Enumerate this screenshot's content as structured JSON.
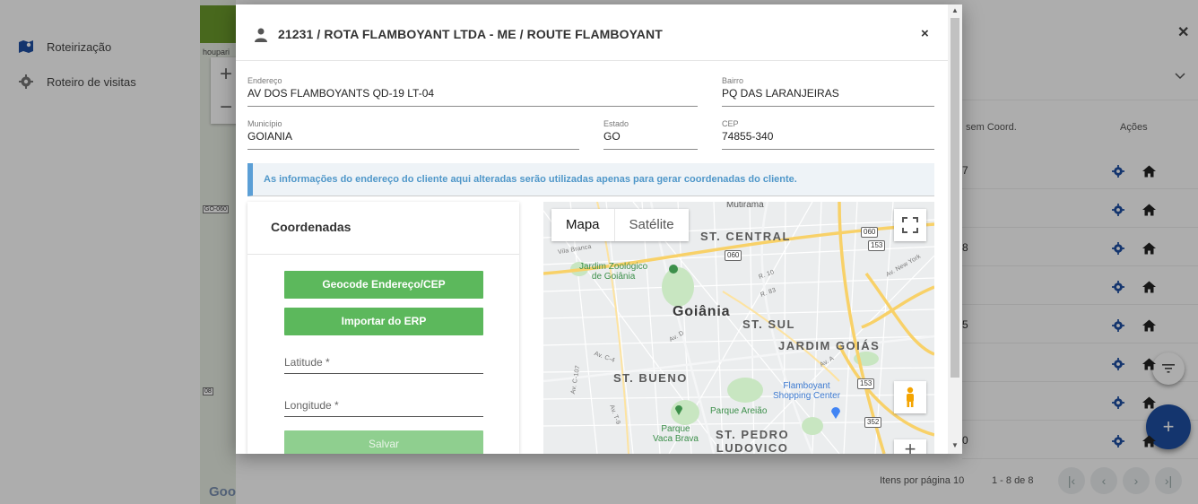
{
  "sidebar": {
    "items": [
      {
        "label": "Roteirização",
        "icon": "map-route-icon"
      },
      {
        "label": "Roteiro de visitas",
        "icon": "gear-icon"
      }
    ]
  },
  "background": {
    "map_credit": "Goo",
    "map_strip_text": "houpari",
    "road_codes": [
      "GO-060",
      "08"
    ],
    "table": {
      "col_sem_coord": "sem Coord.",
      "col_acoes": "Ações",
      "rows": [
        "7",
        "",
        "8",
        "",
        "5",
        "",
        "",
        "0"
      ]
    },
    "footer": {
      "items_per_page": "Itens por página 10",
      "range": "1 - 8 de 8"
    }
  },
  "modal": {
    "title": "21231 / ROTA FLAMBOYANT LTDA - ME / ROUTE FLAMBOYANT",
    "close": "×",
    "fields": {
      "endereco": {
        "label": "Endereço",
        "value": "AV DOS FLAMBOYANTS QD-19 LT-04"
      },
      "bairro": {
        "label": "Bairro",
        "value": "PQ DAS LARANJEIRAS"
      },
      "municipio": {
        "label": "Município",
        "value": "GOIANIA"
      },
      "estado": {
        "label": "Estado",
        "value": "GO"
      },
      "cep": {
        "label": "CEP",
        "value": "74855-340"
      }
    },
    "info": "As informações do endereço do cliente aqui alteradas serão utilizadas apenas para gerar coordenadas do cliente.",
    "coords": {
      "title": "Coordenadas",
      "geocode_button": "Geocode Endereço/CEP",
      "import_button": "Importar do ERP",
      "latitude_placeholder": "Latitude *",
      "longitude_placeholder": "Longitude *",
      "save_button": "Salvar"
    },
    "map": {
      "type_map": "Mapa",
      "type_satellite": "Satélite",
      "labels": {
        "mutirama": "Mutirama",
        "st_central": "ST. CENTRAL",
        "jardim_zoo": "Jardim Zoológico\nde Goiânia",
        "goiania": "Goiânia",
        "st_sul": "ST. SUL",
        "jardim_goias": "JARDIM GOIÁS",
        "st_bueno": "ST. BUENO",
        "flamboyant": "Flamboyant\nShopping Center",
        "parque_areiao": "Parque Areião",
        "parque_vaca": "Parque\nVaca Brava",
        "st_pedro": "ST. PEDRO\nLUDOVICO",
        "av_new_york": "Av. New York",
        "av_c107": "Av. C-107",
        "av_c4": "Av. C-4",
        "av_d": "Av. D",
        "av_t9": "Av. T-9",
        "av_a": "Av. A",
        "r10": "R. 10",
        "r83": "R. 83",
        "vila_branca": "Vila Branca"
      },
      "shields": [
        "060",
        "153",
        "060",
        "153",
        "352"
      ]
    }
  }
}
